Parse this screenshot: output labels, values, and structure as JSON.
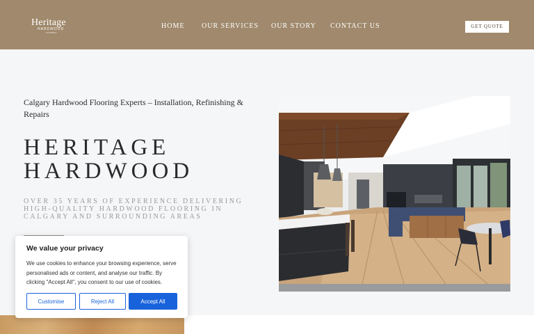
{
  "header": {
    "logo": {
      "main": "Heritage",
      "sub": "HARDWOOD",
      "fine": "FLOORING"
    },
    "nav": [
      {
        "label": "HOME"
      },
      {
        "label": "OUR SERVICES"
      },
      {
        "label": "OUR STORY"
      },
      {
        "label": "CONTACT US"
      }
    ],
    "cta": "GET QUOTE"
  },
  "hero": {
    "tagline": "Calgary Hardwood Flooring Experts – Installation, Refinishing & Repairs",
    "title_line1": "HERITAGE",
    "title_line2": "HARDWOOD",
    "subtitle": "OVER 35 YEARS OF EXPERIENCE DELIVERING HIGH-QUALITY HARDWOOD FLOORING IN CALGARY AND SURROUNDING AREAS"
  },
  "cookie": {
    "title": "We value your privacy",
    "text": "We use cookies to enhance your browsing experience, serve personalised ads or content, and analyse our traffic. By clicking \"Accept All\", you consent to our use of cookies.",
    "customise": "Customise",
    "reject": "Reject All",
    "accept": "Accept All"
  },
  "colors": {
    "header_bg": "#a0896c",
    "accent_blue": "#1863dc"
  }
}
